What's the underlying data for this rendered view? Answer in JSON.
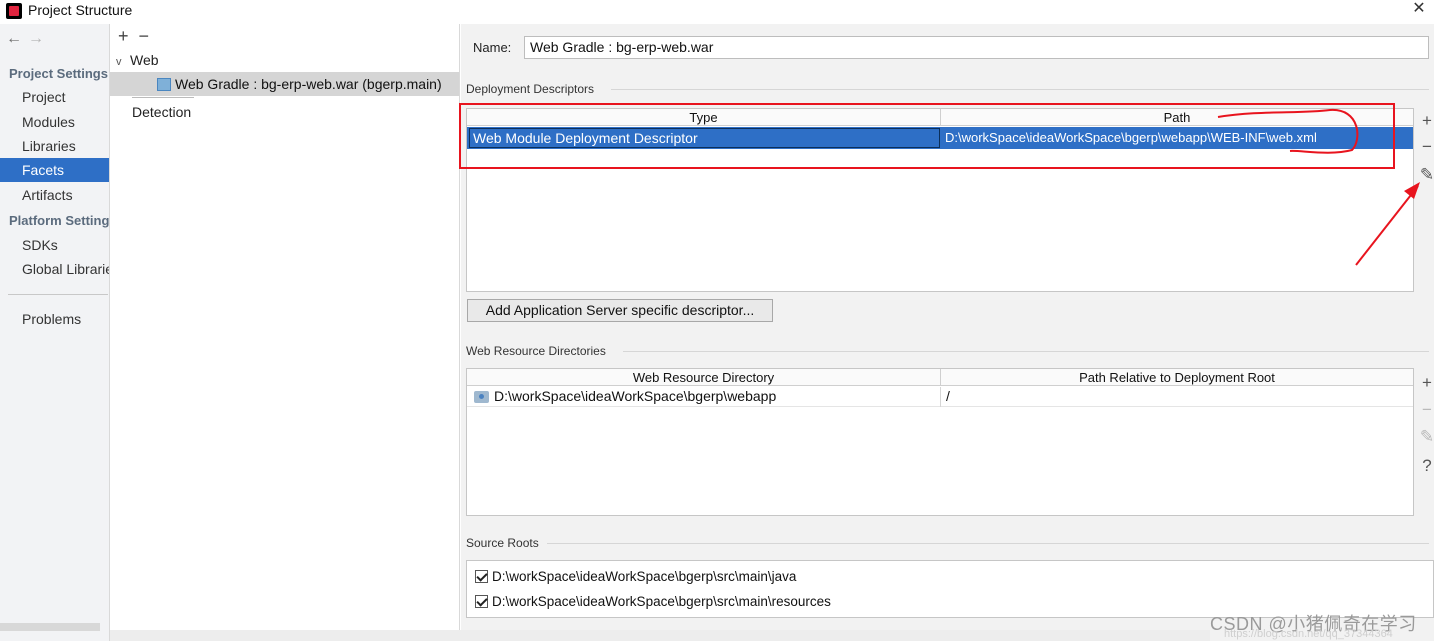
{
  "window": {
    "title": "Project Structure",
    "logo_icon": "intellij-idea-logo-icon",
    "close_icon": "close-icon",
    "close_glyph": "✕"
  },
  "nav": {
    "back_glyph": "←",
    "forward_glyph": "→",
    "project_settings_heading": "Project Settings",
    "project_settings_items": [
      "Project",
      "Modules",
      "Libraries",
      "Facets",
      "Artifacts"
    ],
    "selected_item": "Facets",
    "platform_settings_heading": "Platform Settings",
    "platform_settings_items": [
      "SDKs",
      "Global Libraries"
    ],
    "other_items": [
      "Problems"
    ]
  },
  "tree": {
    "add_glyph": "+",
    "remove_glyph": "−",
    "root_label": "Web",
    "root_chevron": "v",
    "selected_node_label": "Web Gradle : bg-erp-web.war (bgerp.main)",
    "detection_label": "Detection"
  },
  "content": {
    "name_label": "Name:",
    "name_value": "Web Gradle : bg-erp-web.war",
    "deployment_descriptors": {
      "title": "Deployment Descriptors",
      "columns": [
        "Type",
        "Path"
      ],
      "rows": [
        {
          "type": "Web Module Deployment Descriptor",
          "path": "D:\\workSpace\\ideaWorkSpace\\bgerp\\webapp\\WEB-INF\\web.xml"
        }
      ],
      "side_buttons": {
        "add": "+",
        "remove": "−",
        "edit": "✎"
      }
    },
    "add_descriptor_button": "Add Application Server specific descriptor...",
    "web_resource_directories": {
      "title": "Web Resource Directories",
      "columns": [
        "Web Resource Directory",
        "Path Relative to Deployment Root"
      ],
      "rows": [
        {
          "directory": "D:\\workSpace\\ideaWorkSpace\\bgerp\\webapp",
          "relative": "/"
        }
      ],
      "side_buttons": {
        "add": "+",
        "remove": "−",
        "edit": "✎",
        "help": "?"
      }
    },
    "source_roots": {
      "title": "Source Roots",
      "items": [
        {
          "path": "D:\\workSpace\\ideaWorkSpace\\bgerp\\src\\main\\java",
          "checked": true
        },
        {
          "path": "D:\\workSpace\\ideaWorkSpace\\bgerp\\src\\main\\resources",
          "checked": true
        }
      ]
    }
  },
  "watermark": {
    "text": "CSDN @小猪佩奇在学习",
    "url": "https://blog.csdn.net/qq_37344364"
  },
  "colors": {
    "selection_blue": "#2e6fc6",
    "annotation_red": "#e8141e"
  }
}
